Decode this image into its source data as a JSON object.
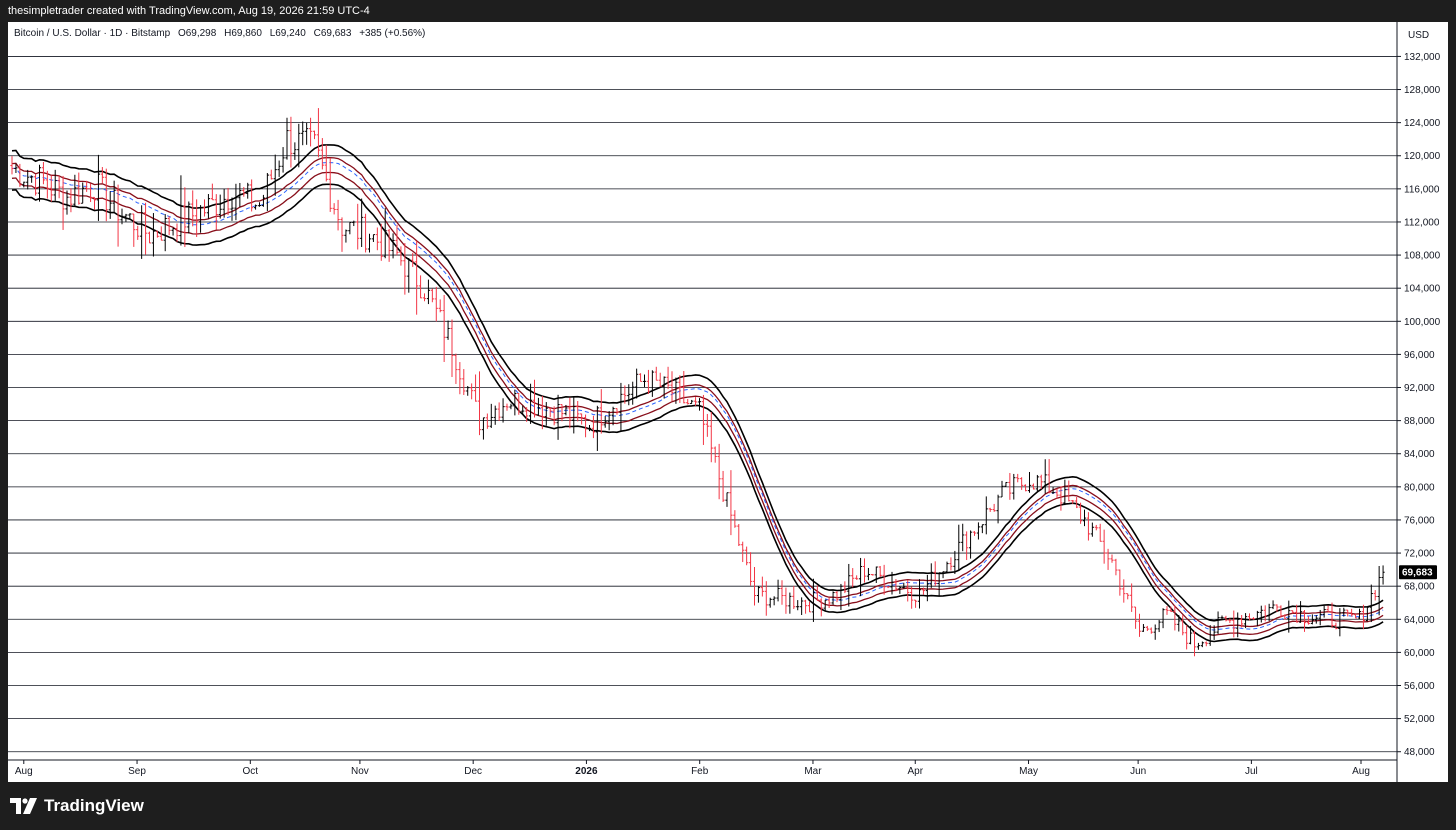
{
  "header": {
    "attribution": "thesimpletrader created with TradingView.com, Aug 19, 2026 21:59 UTC-4"
  },
  "legend": {
    "symbol": "Bitcoin / U.S. Dollar · 1D · Bitstamp",
    "open": "O69,298",
    "high": "H69,860",
    "low": "L69,240",
    "close": "C69,683",
    "change": "+385 (+0.56%)"
  },
  "price_axis": {
    "currency": "USD",
    "last_price_label": "69,683"
  },
  "footer": {
    "brand": "TradingView"
  },
  "colors": {
    "up_bar": "#000000",
    "down_bar": "#f23645",
    "ma_black": "#000000",
    "ma_red": "#880e1a",
    "ma_blue_dashed": "#2962ff",
    "last_price_badge": "#000000"
  },
  "chart_data": {
    "type": "ohlc-bar",
    "symbol": "Bitcoin / U.S. Dollar",
    "interval": "1D",
    "exchange": "Bitstamp",
    "x_tick_labels": [
      "Aug",
      "Sep",
      "Oct",
      "Nov",
      "Dec",
      "2026",
      "Feb",
      "Mar",
      "Apr",
      "May",
      "Jun",
      "Jul",
      "Aug"
    ],
    "y_tick_labels": [
      "48,000",
      "52,000",
      "56,000",
      "60,000",
      "64,000",
      "68,000",
      "72,000",
      "76,000",
      "80,000",
      "84,000",
      "88,000",
      "92,000",
      "96,000",
      "100,000",
      "104,000",
      "108,000",
      "112,000",
      "116,000",
      "120,000",
      "124,000",
      "128,000",
      "132,000"
    ],
    "ylim": [
      47000,
      133500
    ],
    "grid": true,
    "last_price": 69683,
    "price_path_weekly": [
      [
        0,
        118500
      ],
      [
        7,
        117000
      ],
      [
        14,
        115000
      ],
      [
        21,
        116500
      ],
      [
        28,
        113000
      ],
      [
        35,
        110500
      ],
      [
        42,
        112000
      ],
      [
        49,
        113500
      ],
      [
        56,
        115500
      ],
      [
        63,
        114000
      ],
      [
        70,
        122000
      ],
      [
        77,
        121000
      ],
      [
        84,
        111500
      ],
      [
        91,
        110500
      ],
      [
        98,
        108000
      ],
      [
        105,
        104000
      ],
      [
        112,
        97000
      ],
      [
        119,
        88000
      ],
      [
        126,
        90500
      ],
      [
        133,
        90000
      ],
      [
        140,
        89000
      ],
      [
        147,
        87500
      ],
      [
        154,
        90500
      ],
      [
        161,
        93000
      ],
      [
        168,
        91500
      ],
      [
        175,
        89000
      ],
      [
        182,
        78000
      ],
      [
        189,
        67000
      ],
      [
        196,
        66500
      ],
      [
        203,
        66000
      ],
      [
        210,
        67000
      ],
      [
        217,
        70000
      ],
      [
        224,
        68500
      ],
      [
        231,
        67000
      ],
      [
        238,
        71000
      ],
      [
        245,
        75000
      ],
      [
        252,
        79000
      ],
      [
        259,
        81000
      ],
      [
        266,
        79500
      ],
      [
        273,
        76000
      ],
      [
        280,
        71000
      ],
      [
        287,
        62500
      ],
      [
        294,
        64500
      ],
      [
        301,
        61000
      ],
      [
        308,
        63500
      ],
      [
        315,
        64500
      ],
      [
        322,
        65500
      ],
      [
        329,
        64500
      ],
      [
        336,
        64000
      ],
      [
        343,
        64000
      ],
      [
        349,
        69683
      ]
    ],
    "moving_averages": [
      {
        "style": "black-solid-upper"
      },
      {
        "style": "red-solid"
      },
      {
        "style": "blue-dashed"
      },
      {
        "style": "black-solid-lower"
      }
    ]
  }
}
